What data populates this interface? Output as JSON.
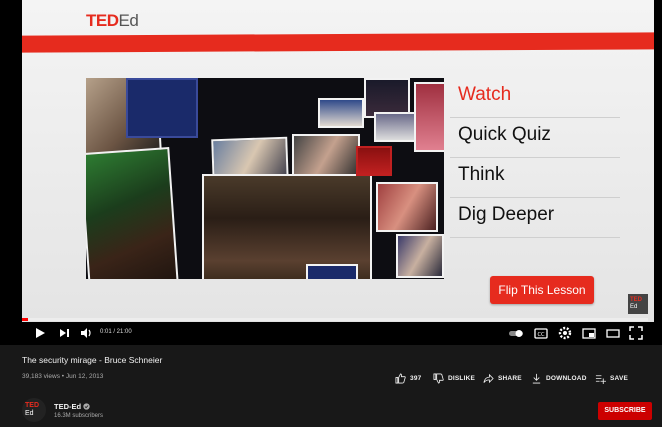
{
  "slide": {
    "logo_ted": "TED",
    "logo_ed": "Ed",
    "menu": [
      "Watch",
      "Quick Quiz",
      "Think",
      "Dig Deeper"
    ],
    "flip_button": "Flip This Lesson",
    "watermark_ted": "TED",
    "watermark_ed": "Ed"
  },
  "player": {
    "time": "0:01 / 21:00",
    "progress": 0.01
  },
  "video": {
    "title": "The security mirage - Bruce Schneier",
    "meta": "39,183 views • Jun 12, 2013"
  },
  "actions": {
    "likes": "397",
    "dislike": "DISLIKE",
    "share": "SHARE",
    "download": "DOWNLOAD",
    "save": "SAVE"
  },
  "channel": {
    "avatar_ted": "TED",
    "avatar_ed": "Ed",
    "name": "TED-Ed",
    "subscribers": "16.3M subscribers",
    "subscribe_label": "SUBSCRIBE"
  },
  "colors": {
    "ted_red": "#e62b1e",
    "youtube_red": "#cc0000",
    "background": "#181818"
  }
}
